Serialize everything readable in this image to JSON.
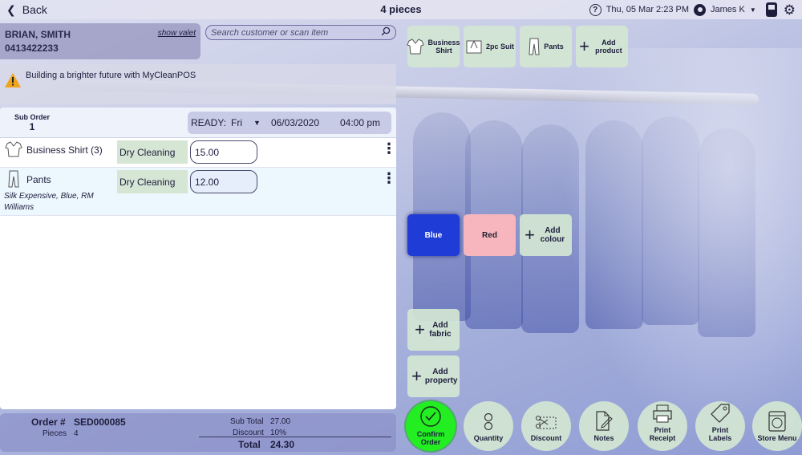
{
  "topbar": {
    "back_label": "Back",
    "title": "4 pieces",
    "help_icon": "?",
    "datetime": "Thu, 05 Mar 2:23 PM",
    "user": "James K"
  },
  "customer": {
    "name": "BRIAN, SMITH",
    "phone": "0413422233",
    "valet_link": "show valet"
  },
  "search": {
    "placeholder": "Search customer or scan item"
  },
  "banner": {
    "message": "Building a brighter future with MyCleanPOS"
  },
  "order": {
    "sub_order_label": "Sub Order",
    "sub_order_number": "1",
    "ready": {
      "label": "READY:",
      "day": "Fri",
      "date": "06/03/2020",
      "time": "04:00 pm"
    },
    "items": [
      {
        "name": "Business Shirt (3)",
        "service": "Dry Cleaning",
        "price": "15.00",
        "details": ""
      },
      {
        "name": "Pants",
        "service": "Dry Cleaning",
        "price": "12.00",
        "details": "Silk Expensive, Blue, RM Williams"
      }
    ]
  },
  "summary": {
    "order_label": "Order #",
    "order_number": "SED000085",
    "pieces_label": "Pieces",
    "pieces": "4",
    "subtotal_label": "Sub Total",
    "subtotal": "27.00",
    "discount_label": "Discount",
    "discount": "10%",
    "total_label": "Total",
    "total": "24.30"
  },
  "products": [
    {
      "label": "Business Shirt",
      "icon": "shirt-icon"
    },
    {
      "label": "2pc Suit",
      "icon": "suit-icon"
    },
    {
      "label": "Pants",
      "icon": "pants-icon"
    },
    {
      "label": "Add product",
      "icon": "plus-icon"
    }
  ],
  "colours": [
    {
      "label": "Blue",
      "color": "#1f3dd6"
    },
    {
      "label": "Red",
      "color": "#f7b6bd"
    },
    {
      "label": "Add colour",
      "icon": "plus-icon"
    }
  ],
  "fabric_button": "Add fabric",
  "property_button": "Add property",
  "actions": [
    {
      "label": "Confirm Order",
      "icon": "check-circle-icon"
    },
    {
      "label": "Quantity",
      "icon": "quantity-icon"
    },
    {
      "label": "Discount",
      "icon": "scissors-coupon-icon"
    },
    {
      "label": "Notes",
      "icon": "notes-icon"
    },
    {
      "label": "Print Receipt",
      "icon": "printer-icon"
    },
    {
      "label": "Print Labels",
      "icon": "tag-icon"
    },
    {
      "label": "Store Menu",
      "icon": "washing-machine-icon"
    }
  ]
}
